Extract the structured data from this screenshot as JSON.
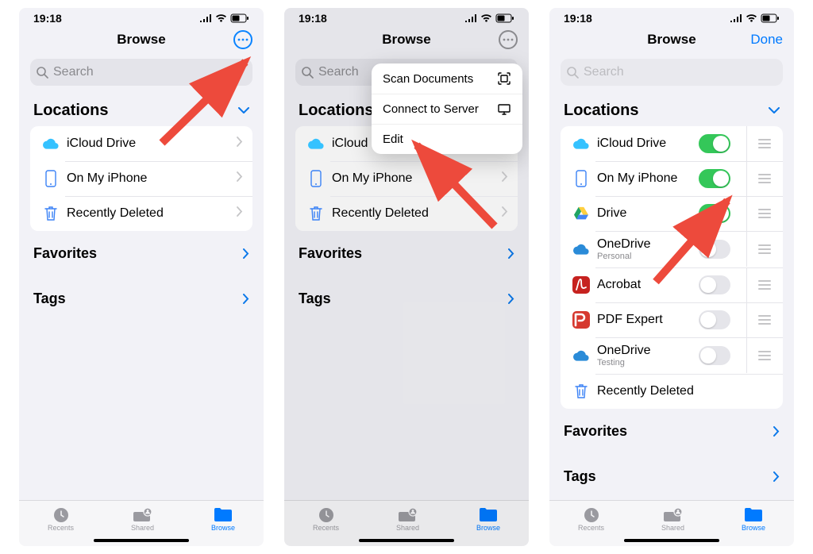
{
  "time": "19:18",
  "browse": "Browse",
  "done": "Done",
  "search_ph": "Search",
  "locations": "Locations",
  "favorites": "Favorites",
  "tags": "Tags",
  "tabs": {
    "recents": "Recents",
    "shared": "Shared",
    "browse": "Browse"
  },
  "rows1": [
    {
      "label": "iCloud Drive"
    },
    {
      "label": "On My iPhone"
    },
    {
      "label": "Recently Deleted"
    }
  ],
  "menu": {
    "scan": "Scan Documents",
    "connect": "Connect to Server",
    "edit": "Edit"
  },
  "rows3": [
    {
      "label": "iCloud Drive",
      "on": true,
      "icon": "cloud"
    },
    {
      "label": "On My iPhone",
      "on": true,
      "icon": "phone"
    },
    {
      "label": "Drive",
      "on": true,
      "icon": "gdrive"
    },
    {
      "label": "OneDrive",
      "sub": "Personal",
      "on": false,
      "icon": "cloud-grey"
    },
    {
      "label": "Acrobat",
      "on": false,
      "icon": "acrobat"
    },
    {
      "label": "PDF Expert",
      "on": false,
      "icon": "pdfx"
    },
    {
      "label": "OneDrive",
      "sub": "Testing",
      "on": false,
      "icon": "cloud-grey"
    },
    {
      "label": "Recently Deleted",
      "icon": "trash",
      "notoggle": true
    }
  ]
}
